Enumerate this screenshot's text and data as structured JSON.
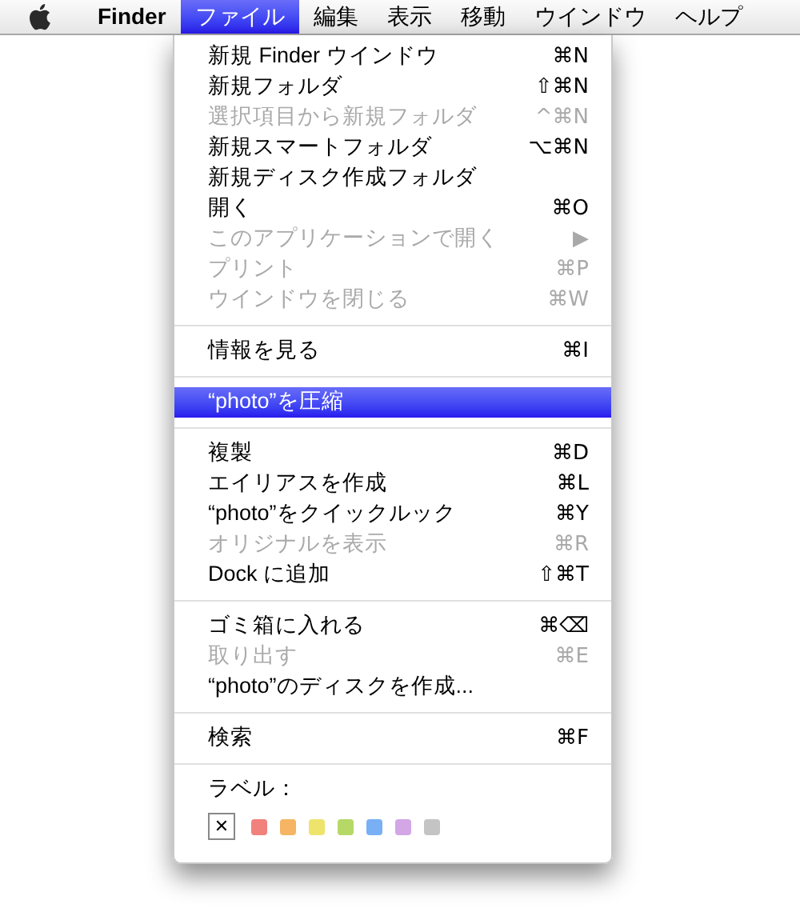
{
  "menubar": {
    "items": [
      {
        "label": "Finder",
        "selected": false,
        "bold": true
      },
      {
        "label": "ファイル",
        "selected": true,
        "bold": false
      },
      {
        "label": "編集",
        "selected": false,
        "bold": false
      },
      {
        "label": "表示",
        "selected": false,
        "bold": false
      },
      {
        "label": "移動",
        "selected": false,
        "bold": false
      },
      {
        "label": "ウインドウ",
        "selected": false,
        "bold": false
      },
      {
        "label": "ヘルプ",
        "selected": false,
        "bold": false
      }
    ]
  },
  "menu": {
    "sections": [
      {
        "items": [
          {
            "label": "新規 Finder ウインドウ",
            "shortcut": "⌘N",
            "disabled": false,
            "selected": false
          },
          {
            "label": "新規フォルダ",
            "shortcut": "⇧⌘N",
            "disabled": false,
            "selected": false
          },
          {
            "label": "選択項目から新規フォルダ",
            "shortcut": "^⌘N",
            "disabled": true,
            "selected": false
          },
          {
            "label": "新規スマートフォルダ",
            "shortcut": "⌥⌘N",
            "disabled": false,
            "selected": false
          },
          {
            "label": "新規ディスク作成フォルダ",
            "disabled": false,
            "selected": false
          },
          {
            "label": "開く",
            "shortcut": "⌘O",
            "disabled": false,
            "selected": false
          },
          {
            "label": "このアプリケーションで開く",
            "shortcut": "▶",
            "disabled": true,
            "selected": false
          },
          {
            "label": "プリント",
            "shortcut": "⌘P",
            "disabled": true,
            "selected": false
          },
          {
            "label": "ウインドウを閉じる",
            "shortcut": "⌘W",
            "disabled": true,
            "selected": false
          }
        ]
      },
      {
        "items": [
          {
            "label": "情報を見る",
            "shortcut": "⌘I",
            "disabled": false,
            "selected": false
          }
        ]
      },
      {
        "items": [
          {
            "label": "“photo”を圧縮",
            "disabled": false,
            "selected": true
          }
        ]
      },
      {
        "items": [
          {
            "label": "複製",
            "shortcut": "⌘D",
            "disabled": false,
            "selected": false
          },
          {
            "label": "エイリアスを作成",
            "shortcut": "⌘L",
            "disabled": false,
            "selected": false
          },
          {
            "label": "“photo”をクイックルック",
            "shortcut": "⌘Y",
            "disabled": false,
            "selected": false
          },
          {
            "label": "オリジナルを表示",
            "shortcut": "⌘R",
            "disabled": true,
            "selected": false
          },
          {
            "label": "Dock に追加",
            "shortcut": "⇧⌘T",
            "disabled": false,
            "selected": false
          }
        ]
      },
      {
        "items": [
          {
            "label": "ゴミ箱に入れる",
            "shortcut": "⌘⌫",
            "disabled": false,
            "selected": false
          },
          {
            "label": "取り出す",
            "shortcut": "⌘E",
            "disabled": true,
            "selected": false
          },
          {
            "label": "“photo”のディスクを作成...",
            "disabled": false,
            "selected": false
          }
        ]
      },
      {
        "items": [
          {
            "label": "検索",
            "shortcut": "⌘F",
            "disabled": false,
            "selected": false
          }
        ]
      }
    ],
    "label_picker": {
      "title": "ラベル：",
      "clear": "✕",
      "swatches": [
        {
          "color": "#f0817b"
        },
        {
          "color": "#f5b562"
        },
        {
          "color": "#eee46c"
        },
        {
          "color": "#b6d867"
        },
        {
          "color": "#79aff5"
        },
        {
          "color": "#d3a6e6"
        },
        {
          "color": "#c4c4c4"
        }
      ]
    }
  }
}
